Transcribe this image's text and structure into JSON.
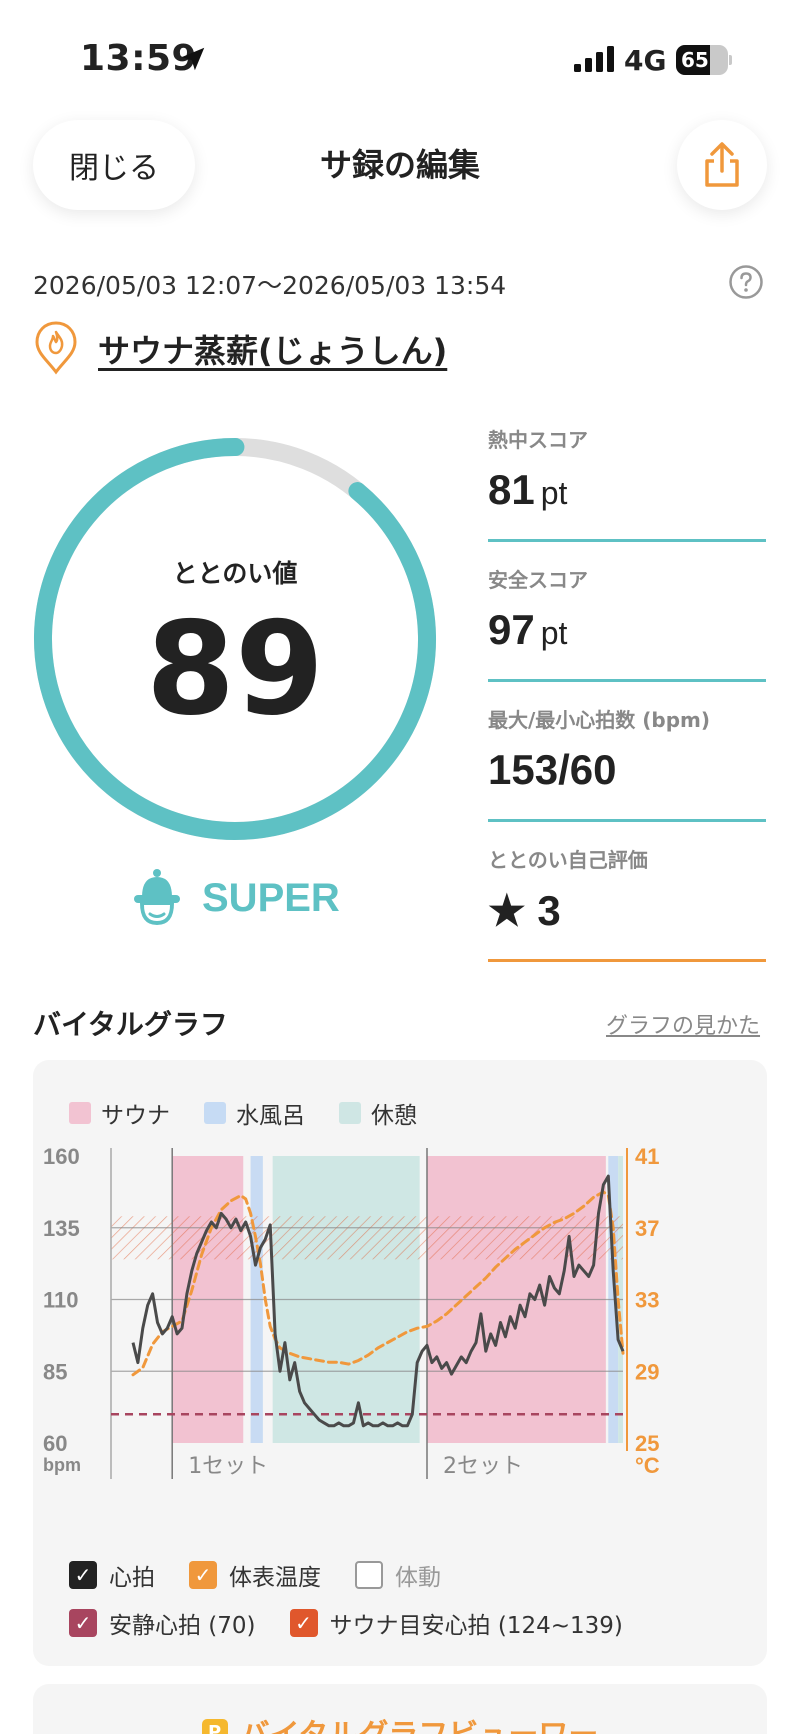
{
  "status": {
    "time": "13:59",
    "network": "4G",
    "battery": "65"
  },
  "nav": {
    "close_label": "閉じる",
    "title": "サ録の編集"
  },
  "session": {
    "date_range": "2026/05/03 12:07〜2026/05/03 13:54"
  },
  "place": {
    "name": "サウナ蒸薪(じょうしん)"
  },
  "score": {
    "label": "ととのい値",
    "value": "89",
    "progress": 0.89,
    "rank": "SUPER"
  },
  "metrics": [
    {
      "label": "熱中スコア",
      "value": "81",
      "unit": "pt"
    },
    {
      "label": "安全スコア",
      "value": "97",
      "unit": "pt"
    },
    {
      "label": "最大/最小心拍数 (bpm)",
      "value": "153/60",
      "unit": ""
    },
    {
      "label": "ととのい自己評価",
      "value": "★ 3",
      "unit": ""
    }
  ],
  "vital": {
    "title": "バイタルグラフ",
    "howto_label": "グラフの見かた",
    "legend": [
      {
        "label": "サウナ",
        "color": "#f2c3d2"
      },
      {
        "label": "水風呂",
        "color": "#c6dbf4"
      },
      {
        "label": "休憩",
        "color": "#cfe6e4"
      }
    ],
    "checks": [
      {
        "label": "心拍",
        "checked": true,
        "color": "#222222"
      },
      {
        "label": "体表温度",
        "checked": true,
        "color": "#f0983c"
      },
      {
        "label": "体動",
        "checked": false,
        "color": "#999999"
      },
      {
        "label": "安静心拍 (70)",
        "checked": true,
        "color": "#a8455f"
      },
      {
        "label": "サウナ目安心拍 (124~139)",
        "checked": true,
        "color": "#e0572c"
      }
    ],
    "viewer_label": "バイタルグラフビューワー",
    "viewer_badge": "P"
  },
  "chart_data": {
    "type": "line",
    "y_left": {
      "unit": "bpm",
      "ticks": [
        "160",
        "135",
        "110",
        "85",
        "60"
      ],
      "range": [
        60,
        160
      ]
    },
    "y_right": {
      "unit": "°C",
      "ticks": [
        "41",
        "37",
        "33",
        "29",
        "25"
      ],
      "range": [
        25,
        41
      ]
    },
    "x_range": [
      0,
      100
    ],
    "set_labels": [
      {
        "label": "1セット",
        "x": 8
      },
      {
        "label": "2セット",
        "x": 60
      }
    ],
    "resting_hr": 70,
    "target_hr_band": [
      124,
      139
    ],
    "segments": [
      {
        "type": "sauna",
        "start": 8,
        "end": 22.5
      },
      {
        "type": "water",
        "start": 24,
        "end": 26.5
      },
      {
        "type": "rest",
        "start": 28.5,
        "end": 58.5
      },
      {
        "type": "sauna",
        "start": 60,
        "end": 96.5
      },
      {
        "type": "water",
        "start": 97,
        "end": 99
      },
      {
        "type": "rest",
        "start": 99,
        "end": 100
      }
    ],
    "series": [
      {
        "name": "心拍",
        "axis": "left",
        "points": [
          [
            0,
            95
          ],
          [
            1,
            88
          ],
          [
            2,
            100
          ],
          [
            3,
            108
          ],
          [
            4,
            112
          ],
          [
            5,
            102
          ],
          [
            6,
            98
          ],
          [
            7,
            100
          ],
          [
            8,
            104
          ],
          [
            9,
            98
          ],
          [
            10,
            100
          ],
          [
            11,
            112
          ],
          [
            12,
            120
          ],
          [
            13,
            126
          ],
          [
            14,
            130
          ],
          [
            15,
            134
          ],
          [
            16,
            137
          ],
          [
            17,
            135
          ],
          [
            18,
            140
          ],
          [
            19,
            138
          ],
          [
            20,
            135
          ],
          [
            21,
            138
          ],
          [
            22,
            134
          ],
          [
            23,
            137
          ],
          [
            24,
            132
          ],
          [
            25,
            122
          ],
          [
            26,
            128
          ],
          [
            27,
            131
          ],
          [
            28,
            136
          ],
          [
            29,
            98
          ],
          [
            30,
            85
          ],
          [
            31,
            95
          ],
          [
            32,
            82
          ],
          [
            33,
            88
          ],
          [
            34,
            78
          ],
          [
            35,
            74
          ],
          [
            36,
            72
          ],
          [
            37,
            70
          ],
          [
            38,
            68
          ],
          [
            39,
            67
          ],
          [
            40,
            66
          ],
          [
            41,
            66
          ],
          [
            42,
            67
          ],
          [
            43,
            66
          ],
          [
            44,
            66
          ],
          [
            45,
            67
          ],
          [
            46,
            74
          ],
          [
            47,
            66
          ],
          [
            48,
            67
          ],
          [
            49,
            66
          ],
          [
            50,
            66
          ],
          [
            51,
            67
          ],
          [
            52,
            66
          ],
          [
            53,
            66
          ],
          [
            54,
            67
          ],
          [
            55,
            66
          ],
          [
            56,
            66
          ],
          [
            57,
            70
          ],
          [
            58,
            88
          ],
          [
            59,
            92
          ],
          [
            60,
            94
          ],
          [
            61,
            88
          ],
          [
            62,
            90
          ],
          [
            63,
            86
          ],
          [
            64,
            88
          ],
          [
            65,
            84
          ],
          [
            66,
            87
          ],
          [
            67,
            90
          ],
          [
            68,
            88
          ],
          [
            69,
            92
          ],
          [
            70,
            95
          ],
          [
            71,
            105
          ],
          [
            72,
            92
          ],
          [
            73,
            98
          ],
          [
            74,
            94
          ],
          [
            75,
            102
          ],
          [
            76,
            97
          ],
          [
            77,
            104
          ],
          [
            78,
            100
          ],
          [
            79,
            108
          ],
          [
            80,
            104
          ],
          [
            81,
            112
          ],
          [
            82,
            110
          ],
          [
            83,
            115
          ],
          [
            84,
            108
          ],
          [
            85,
            118
          ],
          [
            86,
            114
          ],
          [
            87,
            112
          ],
          [
            88,
            120
          ],
          [
            89,
            132
          ],
          [
            90,
            118
          ],
          [
            91,
            122
          ],
          [
            92,
            120
          ],
          [
            93,
            118
          ],
          [
            94,
            122
          ],
          [
            95,
            140
          ],
          [
            96,
            150
          ],
          [
            97,
            153
          ],
          [
            98,
            120
          ],
          [
            99,
            96
          ],
          [
            100,
            92
          ]
        ]
      },
      {
        "name": "体表温度",
        "axis": "right",
        "points": [
          [
            0,
            28.8
          ],
          [
            2,
            29.2
          ],
          [
            4,
            30.5
          ],
          [
            6,
            31.2
          ],
          [
            8,
            31.5
          ],
          [
            10,
            31.8
          ],
          [
            12,
            33.5
          ],
          [
            14,
            35.5
          ],
          [
            16,
            37.0
          ],
          [
            18,
            38.0
          ],
          [
            20,
            38.5
          ],
          [
            22,
            38.8
          ],
          [
            23,
            38.6
          ],
          [
            24,
            37.8
          ],
          [
            25,
            36.5
          ],
          [
            26,
            35.0
          ],
          [
            27,
            33.0
          ],
          [
            28,
            31.5
          ],
          [
            29,
            30.8
          ],
          [
            30,
            30.3
          ],
          [
            32,
            30.0
          ],
          [
            34,
            29.8
          ],
          [
            36,
            29.7
          ],
          [
            38,
            29.6
          ],
          [
            40,
            29.5
          ],
          [
            42,
            29.5
          ],
          [
            44,
            29.4
          ],
          [
            46,
            29.6
          ],
          [
            48,
            29.9
          ],
          [
            50,
            30.3
          ],
          [
            52,
            30.6
          ],
          [
            54,
            30.9
          ],
          [
            56,
            31.2
          ],
          [
            58,
            31.4
          ],
          [
            60,
            31.5
          ],
          [
            62,
            31.8
          ],
          [
            64,
            32.2
          ],
          [
            66,
            32.7
          ],
          [
            68,
            33.2
          ],
          [
            70,
            33.7
          ],
          [
            72,
            34.2
          ],
          [
            74,
            34.8
          ],
          [
            76,
            35.3
          ],
          [
            78,
            35.8
          ],
          [
            80,
            36.2
          ],
          [
            82,
            36.6
          ],
          [
            84,
            37.0
          ],
          [
            86,
            37.3
          ],
          [
            88,
            37.5
          ],
          [
            90,
            37.8
          ],
          [
            92,
            38.2
          ],
          [
            94,
            38.7
          ],
          [
            96,
            39.0
          ],
          [
            97,
            38.8
          ],
          [
            98,
            37.0
          ],
          [
            99,
            33.0
          ],
          [
            100,
            30.0
          ]
        ]
      }
    ]
  }
}
